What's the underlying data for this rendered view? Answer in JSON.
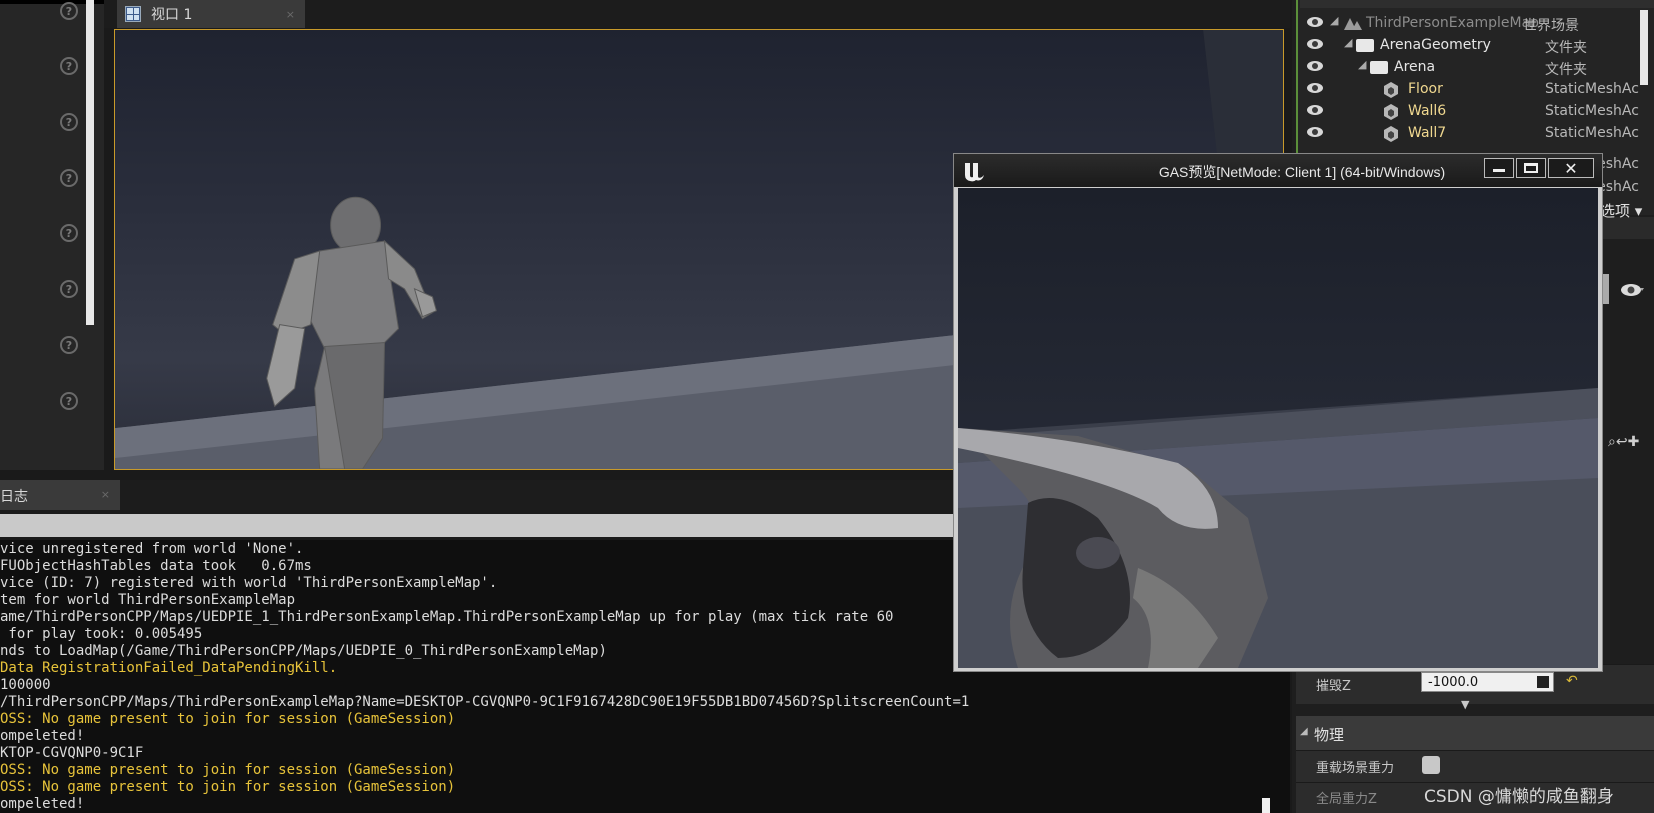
{
  "viewport": {
    "tab_label": "视口 1"
  },
  "log": {
    "tab_label": "日志",
    "lines": [
      {
        "text": "vice unregistered from world 'None'.",
        "level": "normal"
      },
      {
        "text": "FUObjectHashTables data took   0.67ms",
        "level": "normal"
      },
      {
        "text": "vice (ID: 7) registered with world 'ThirdPersonExampleMap'.",
        "level": "normal"
      },
      {
        "text": "tem for world ThirdPersonExampleMap",
        "level": "normal"
      },
      {
        "text": "ame/ThirdPersonCPP/Maps/UEDPIE_1_ThirdPersonExampleMap.ThirdPersonExampleMap up for play (max tick rate 60",
        "level": "normal"
      },
      {
        "text": " for play took: 0.005495",
        "level": "normal"
      },
      {
        "text": "nds to LoadMap(/Game/ThirdPersonCPP/Maps/UEDPIE_0_ThirdPersonExampleMap)",
        "level": "normal"
      },
      {
        "text": "Data RegistrationFailed_DataPendingKill.",
        "level": "warn"
      },
      {
        "text": "100000",
        "level": "normal"
      },
      {
        "text": "/ThirdPersonCPP/Maps/ThirdPersonExampleMap?Name=DESKTOP-CGVQNP0-9C1F9167428DC90E19F55DB1BD07456D?SplitscreenCount=1",
        "level": "normal"
      },
      {
        "text": "OSS: No game present to join for session (GameSession)",
        "level": "warn"
      },
      {
        "text": "ompeleted!",
        "level": "normal"
      },
      {
        "text": "KTOP-CGVQNP0-9C1F",
        "level": "normal"
      },
      {
        "text": "OSS: No game present to join for session (GameSession)",
        "level": "warn"
      },
      {
        "text": "OSS: No game present to join for session (GameSession)",
        "level": "warn"
      },
      {
        "text": "ompeleted!",
        "level": "normal"
      }
    ]
  },
  "outliner": {
    "rows": [
      {
        "name": "ThirdPersonExampleMap",
        "type": "世界场景",
        "kind": "world",
        "indent": 0,
        "dim": true
      },
      {
        "name": "ArenaGeometry",
        "type": "文件夹",
        "kind": "folder",
        "indent": 1,
        "dim": false
      },
      {
        "name": "Arena",
        "type": "文件夹",
        "kind": "folder",
        "indent": 2,
        "dim": false
      },
      {
        "name": "Floor",
        "type": "StaticMeshAc",
        "kind": "mesh",
        "indent": 3,
        "dim": false
      },
      {
        "name": "Wall6",
        "type": "StaticMeshAc",
        "kind": "mesh",
        "indent": 3,
        "dim": false
      },
      {
        "name": "Wall7",
        "type": "StaticMeshAc",
        "kind": "mesh",
        "indent": 3,
        "dim": false
      }
    ],
    "hidden_types": [
      "StaticMeshAc",
      "StaticMeshAc"
    ],
    "options_label": "选项"
  },
  "details": {
    "kill_z_label": "摧毁Z",
    "kill_z_value": "-1000.0",
    "physics_section": "物理",
    "override_gravity_label": "重载场景重力",
    "global_gravity_label": "全局重力Z"
  },
  "pie": {
    "title": "GAS预览[NetMode: Client 1]  (64-bit/Windows)"
  },
  "watermark": "CSDN @慵懒的咸鱼翻身",
  "colors": {
    "accent_border": "#c89a2a",
    "warn_text": "#e7c33a",
    "outliner_mesh_text": "#f0d890",
    "outliner_border": "#5b8f3a"
  }
}
